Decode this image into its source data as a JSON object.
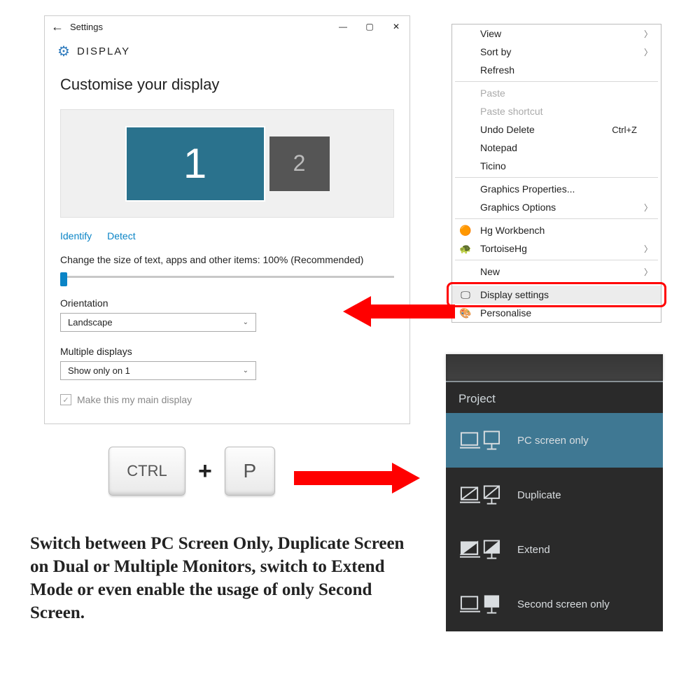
{
  "settings": {
    "app_title": "Settings",
    "page": "DISPLAY",
    "heading": "Customise your display",
    "monitor1": "1",
    "monitor2": "2",
    "identify": "Identify",
    "detect": "Detect",
    "scale_label": "Change the size of text, apps and other items: 100% (Recommended)",
    "orientation_label": "Orientation",
    "orientation_value": "Landscape",
    "multi_label": "Multiple displays",
    "multi_value": "Show only on 1",
    "main_chk": "Make this my main display"
  },
  "ctx": {
    "view": "View",
    "sort": "Sort by",
    "refresh": "Refresh",
    "paste": "Paste",
    "paste_shortcut": "Paste shortcut",
    "undo": "Undo Delete",
    "undo_key": "Ctrl+Z",
    "notepad": "Notepad",
    "ticino": "Ticino",
    "gfx_props": "Graphics Properties...",
    "gfx_opts": "Graphics Options",
    "hg": "Hg Workbench",
    "tortoise": "TortoiseHg",
    "new": "New",
    "display": "Display settings",
    "personalise": "Personalise"
  },
  "keys": {
    "ctrl": "CTRL",
    "p": "P"
  },
  "project": {
    "title": "Project",
    "pc": "PC screen only",
    "dup": "Duplicate",
    "ext": "Extend",
    "sec": "Second screen only"
  },
  "caption": "Switch between PC Screen Only, Duplicate Screen on Dual or Multiple Monitors, switch to Extend Mode or even enable the usage of only Second Screen."
}
